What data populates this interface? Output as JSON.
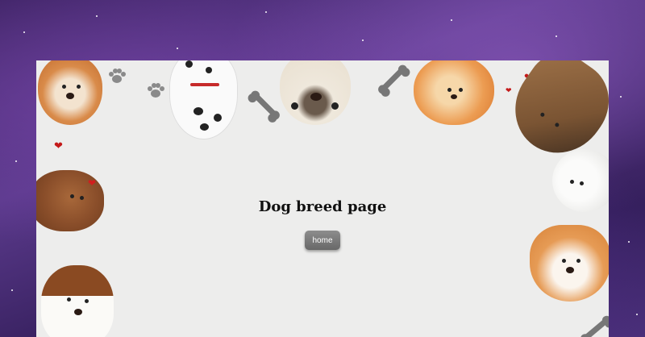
{
  "page": {
    "title": "Dog breed page"
  },
  "nav": {
    "home_label": "home"
  },
  "colors": {
    "panel_background": "#ededec",
    "button_background": "#777777",
    "heart": "#c41a1a"
  },
  "decorations": {
    "dogs": [
      "shiba-inu",
      "dalmatian",
      "pug",
      "pomeranian",
      "german-shepherd",
      "yorkshire-terrier",
      "maltese",
      "corgi",
      "jack-russell-terrier"
    ],
    "icons": [
      "bone-icon",
      "paw-print-icon",
      "heart-icon"
    ]
  }
}
